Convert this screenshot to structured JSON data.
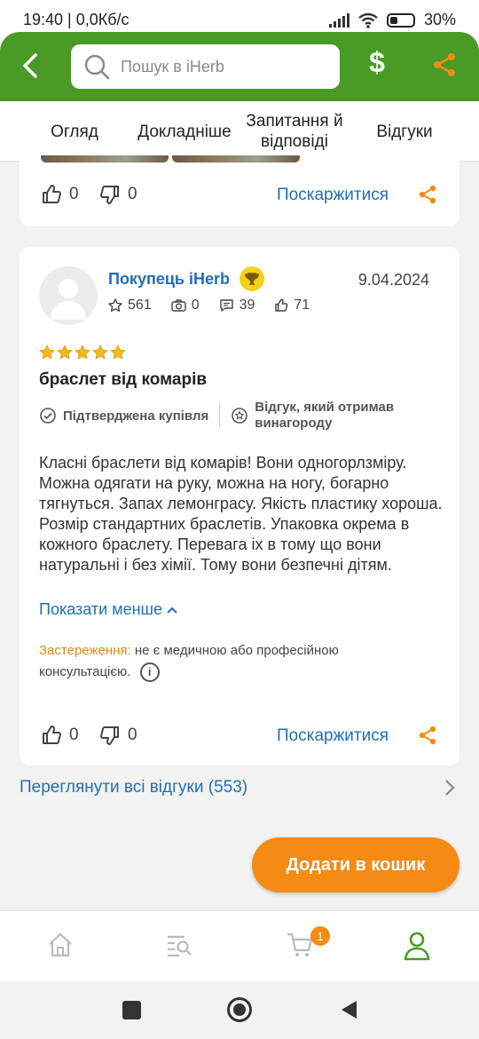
{
  "status_bar": {
    "time": "19:40 | 0,0Кб/с",
    "battery": "30%"
  },
  "header": {
    "search_placeholder": "Пошук в iHerb",
    "currency_symbol": "$"
  },
  "tabs": [
    {
      "label": "Огляд"
    },
    {
      "label": "Докладніше"
    },
    {
      "label": "Запитання й відповіді"
    },
    {
      "label": "Відгуки",
      "active": true
    }
  ],
  "review_prev": {
    "likes": "0",
    "dislikes": "0",
    "report_label": "Поскаржитися"
  },
  "review": {
    "user": "Покупець iHerb",
    "date": "9.04.2024",
    "stats": {
      "stars": "561",
      "photos": "0",
      "comments": "39",
      "likes": "71"
    },
    "rating": 5,
    "title": "браслет від комарів",
    "badge_verified": "Підтверджена купівля",
    "badge_rewarded": "Відгук, який отримав винагороду",
    "text": "Класні браслети від комарів! Вони одногорлзміру. Можна одягати на руку, можна на ногу, богарно тягнуться. Запах лемонграсу. Якість пластику хороша. Розмір стандартних браслетів. Упаковка окрема в кожного браслету. Перевага іх в тому що вони натуральні і без хімії. Тому вони безпечні дітям.",
    "show_less": "Показати менше",
    "warning_label": "Застереження:",
    "warning_text": "не є медичною або професійною консультацією.",
    "likes": "0",
    "dislikes": "0",
    "report_label": "Поскаржитися"
  },
  "view_all": "Переглянути всі відгуки (553)",
  "add_to_cart": "Додати в кошик",
  "bottom_nav": {
    "cart_count": "1"
  },
  "colors": {
    "brand_green": "#4a9a26",
    "accent_orange": "#f48b14",
    "link_blue": "#1f6fb5"
  }
}
